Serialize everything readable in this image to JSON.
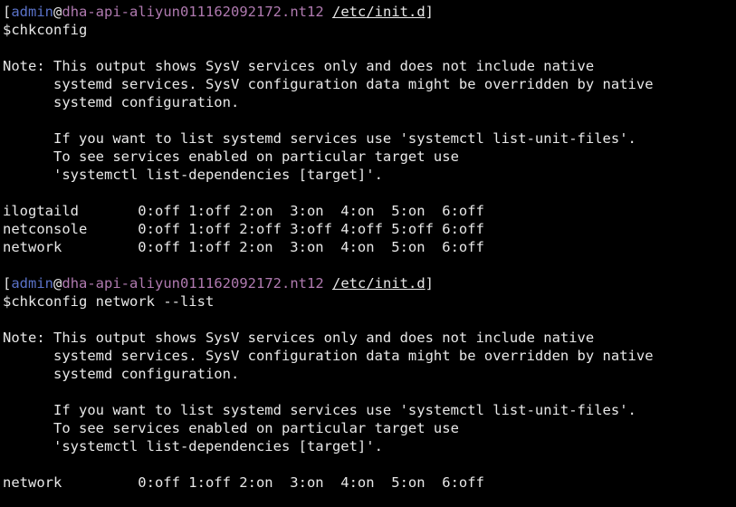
{
  "colors": {
    "background": "#000000",
    "foreground": "#e8e8e8",
    "user": "#5a72c8",
    "host": "#b07ab0"
  },
  "prompt": {
    "open_bracket": "[",
    "user": "admin",
    "at": "@",
    "host": "dha-api-aliyun011162092172.nt12",
    "space": " ",
    "path": "/etc/init.d",
    "close_bracket": "]",
    "sigil": "$"
  },
  "blocks": [
    {
      "command": "chkconfig",
      "note": [
        "Note: This output shows SysV services only and does not include native",
        "      systemd services. SysV configuration data might be overridden by native",
        "      systemd configuration.",
        "",
        "      If you want to list systemd services use 'systemctl list-unit-files'.",
        "      To see services enabled on particular target use",
        "      'systemctl list-dependencies [target]'."
      ],
      "services": [
        "ilogtaild       0:off 1:off 2:on  3:on  4:on  5:on  6:off",
        "netconsole      0:off 1:off 2:off 3:off 4:off 5:off 6:off",
        "network         0:off 1:off 2:on  3:on  4:on  5:on  6:off"
      ]
    },
    {
      "command": "chkconfig network --list",
      "note": [
        "Note: This output shows SysV services only and does not include native",
        "      systemd services. SysV configuration data might be overridden by native",
        "      systemd configuration.",
        "",
        "      If you want to list systemd services use 'systemctl list-unit-files'.",
        "      To see services enabled on particular target use",
        "      'systemctl list-dependencies [target]'."
      ],
      "services": [
        "network         0:off 1:off 2:on  3:on  4:on  5:on  6:off"
      ]
    }
  ]
}
